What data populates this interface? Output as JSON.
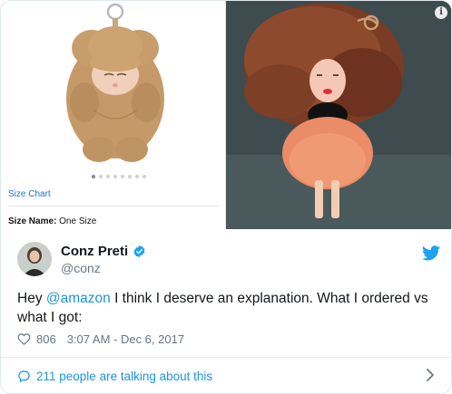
{
  "media": {
    "left": {
      "size_chart_link": "Size Chart",
      "size_name_label": "Size Name:",
      "size_name_value": "One Size",
      "carousel_dot_count": 8
    },
    "right": {
      "info_glyph": "i"
    }
  },
  "tweet": {
    "display_name": "Conz Preti",
    "handle": "@conz",
    "verified": true,
    "text_prefix": "Hey ",
    "mention": "@amazon",
    "text_suffix": " I think I deserve an explanation. What I ordered vs what I got:",
    "like_count": "806",
    "timestamp": "3:07 AM - Dec 6, 2017",
    "talking_text": "211 people are talking about this"
  },
  "colors": {
    "link_blue": "#1b95e0",
    "verified_blue": "#1da1f2",
    "secondary_text": "#657786"
  },
  "icons": [
    "info-icon",
    "verified-badge-icon",
    "twitter-bird-icon",
    "heart-icon",
    "comment-bubble-icon",
    "chevron-right-icon"
  ]
}
